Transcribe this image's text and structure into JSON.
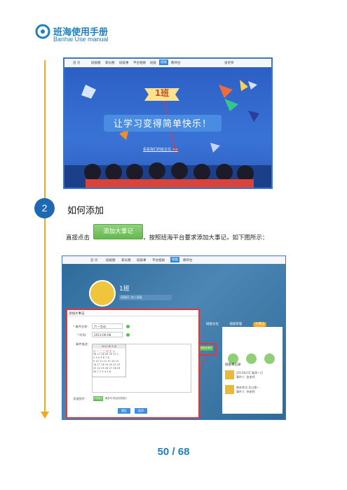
{
  "header": {
    "brand_cn": "班海使用手册",
    "brand_en": "Banhai Use manual"
  },
  "screenshot1": {
    "nav_items": [
      "首 页",
      "班级圈",
      "家长圈",
      "班级事",
      "平台相册",
      "班级",
      "班级",
      "教师台"
    ],
    "active_nav": "班级",
    "user_text": "张老师",
    "class_name": "1班",
    "slogan": "让学习变得简单快乐！",
    "link": "看看我们的班主任 >>"
  },
  "section2": {
    "number": "2",
    "title": "如何添加",
    "instruction_before": "直接点击",
    "button_label": "添加大事记",
    "instruction_after": "，按照班海平台要求添加大事记，如下图所示："
  },
  "screenshot2": {
    "nav_items": [
      "首 页",
      "班级圈",
      "家长圈",
      "班级事",
      "平台相册",
      "班级",
      "教师台"
    ],
    "class_name": "1班",
    "class_sub": "班级码: 加入班级",
    "tabs": [
      "班级文化",
      "班级荣誉",
      "大事记"
    ],
    "right_title": "班级事记录",
    "right_items": [
      {
        "title": "2013年2月  春游一日",
        "sub": "事件人: 张老师"
      },
      {
        "title": "期末考试  总分第一",
        "sub": "事件人: 李老师"
      }
    ],
    "dialog": {
      "title": "添加大事记",
      "name_label": "* 事件名称：",
      "name_value": "六一活动",
      "time_label": "* 时间：",
      "time_value": "2013-06-08",
      "desc_label": "事件描述：",
      "cal_header": "2013 年 6 月",
      "cal_rows": [
        "日 一 二 三 四 五 六",
        "26 27 28 29 30 31 1",
        "2 3 4 5 6 7 8",
        "9 10 11 12 13 14 15",
        "16 17 18 19 20 21 22",
        "23 24 25 26 27 28 29",
        "30 1 2 3 4 5 6"
      ],
      "upload_label": "添加图片：",
      "upload_button": "浏览图片",
      "upload_hint": "最多可添加四张图片",
      "ok": "确定",
      "cancel": "取消"
    },
    "highlight_button": "添加大事记"
  },
  "footer": {
    "page": "50 / 68"
  },
  "colors": {
    "brand": "#1f7fc0",
    "timeline": "#f0a81e",
    "green": "#66b84e",
    "highlight": "#e0373c"
  }
}
